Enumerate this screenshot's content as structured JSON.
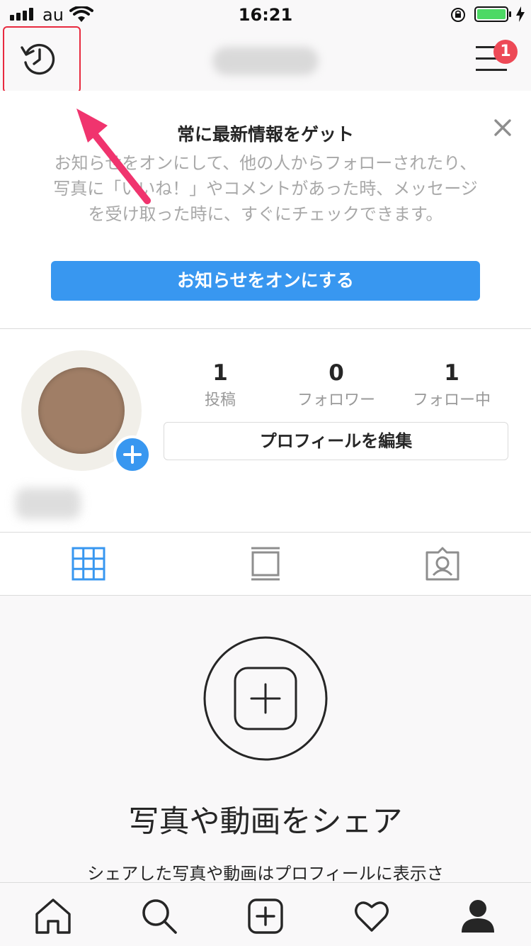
{
  "status_bar": {
    "carrier": "au",
    "time": "16:21",
    "battery_color": "#4cd964"
  },
  "header": {
    "username": "",
    "menu_badge_count": "1",
    "history_icon": "history-icon",
    "menu_icon": "menu-icon"
  },
  "notification": {
    "title": "常に最新情報をゲット",
    "body": "お知らせをオンにして、他の人からフォローされたり、写真に「いいね！」やコメントがあった時、メッセージを受け取った時に、すぐにチェックできます。",
    "button_label": "お知らせをオンにする",
    "close_icon": "close-icon",
    "button_color": "#3897f0"
  },
  "profile": {
    "stats": [
      {
        "value": "1",
        "label": "投稿"
      },
      {
        "value": "0",
        "label": "フォロワー"
      },
      {
        "value": "1",
        "label": "フォロー中"
      }
    ],
    "edit_button": "プロフィールを編集",
    "display_name": ""
  },
  "tabs": {
    "items": [
      "grid-icon",
      "feed-icon",
      "tagged-icon"
    ],
    "active": "grid-icon",
    "active_color": "#3897f0"
  },
  "empty_state": {
    "title": "写真や動画をシェア",
    "subtitle": "シェアした写真や動画はプロフィールに表示さ"
  },
  "bottom_nav": {
    "items": [
      "home-icon",
      "search-icon",
      "add-post-icon",
      "activity-icon",
      "profile-icon"
    ]
  },
  "annotation": {
    "highlight_color": "#e82a3f",
    "arrow_color": "#f0346e"
  }
}
